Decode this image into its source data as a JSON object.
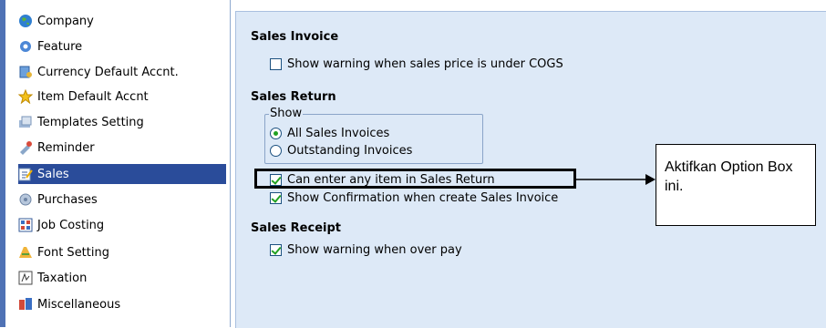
{
  "sidebar": {
    "items": [
      {
        "label": "Company",
        "icon": "globe-icon"
      },
      {
        "label": "Feature",
        "icon": "gear-icon"
      },
      {
        "label": "Currency Default Accnt.",
        "icon": "currency-icon"
      },
      {
        "label": "Item Default Accnt",
        "icon": "star-icon"
      },
      {
        "label": "Templates Setting",
        "icon": "templates-icon"
      },
      {
        "label": "Reminder",
        "icon": "reminder-icon"
      },
      {
        "label": "Sales",
        "icon": "sales-icon",
        "selected": true
      },
      {
        "label": "Purchases",
        "icon": "purchases-icon"
      },
      {
        "label": "Job Costing",
        "icon": "job-costing-icon"
      },
      {
        "label": "Font Setting",
        "icon": "font-icon"
      },
      {
        "label": "Taxation",
        "icon": "taxation-icon"
      },
      {
        "label": "Miscellaneous",
        "icon": "misc-icon"
      }
    ]
  },
  "panel": {
    "sales_invoice": {
      "title": "Sales Invoice",
      "warn_under_cogs": {
        "label": "Show warning when sales price is under COGS",
        "checked": false
      }
    },
    "sales_return": {
      "title": "Sales Return",
      "show_group_label": "Show",
      "show_all": {
        "label": "All Sales Invoices",
        "selected": true
      },
      "show_outstanding": {
        "label": "Outstanding Invoices",
        "selected": false
      },
      "any_item": {
        "label": "Can enter any item in Sales Return",
        "checked": true
      },
      "show_confirmation": {
        "label": "Show Confirmation when create Sales Invoice",
        "checked": true
      }
    },
    "sales_receipt": {
      "title": "Sales Receipt",
      "warn_over_pay": {
        "label": "Show warning when over pay",
        "checked": true
      }
    }
  },
  "annotation": {
    "callout_text": "Aktifkan Option Box ini."
  },
  "colors": {
    "panel_bg": "#dde9f7",
    "selected_bg": "#2a4c9a",
    "check_green": "#21a121"
  }
}
